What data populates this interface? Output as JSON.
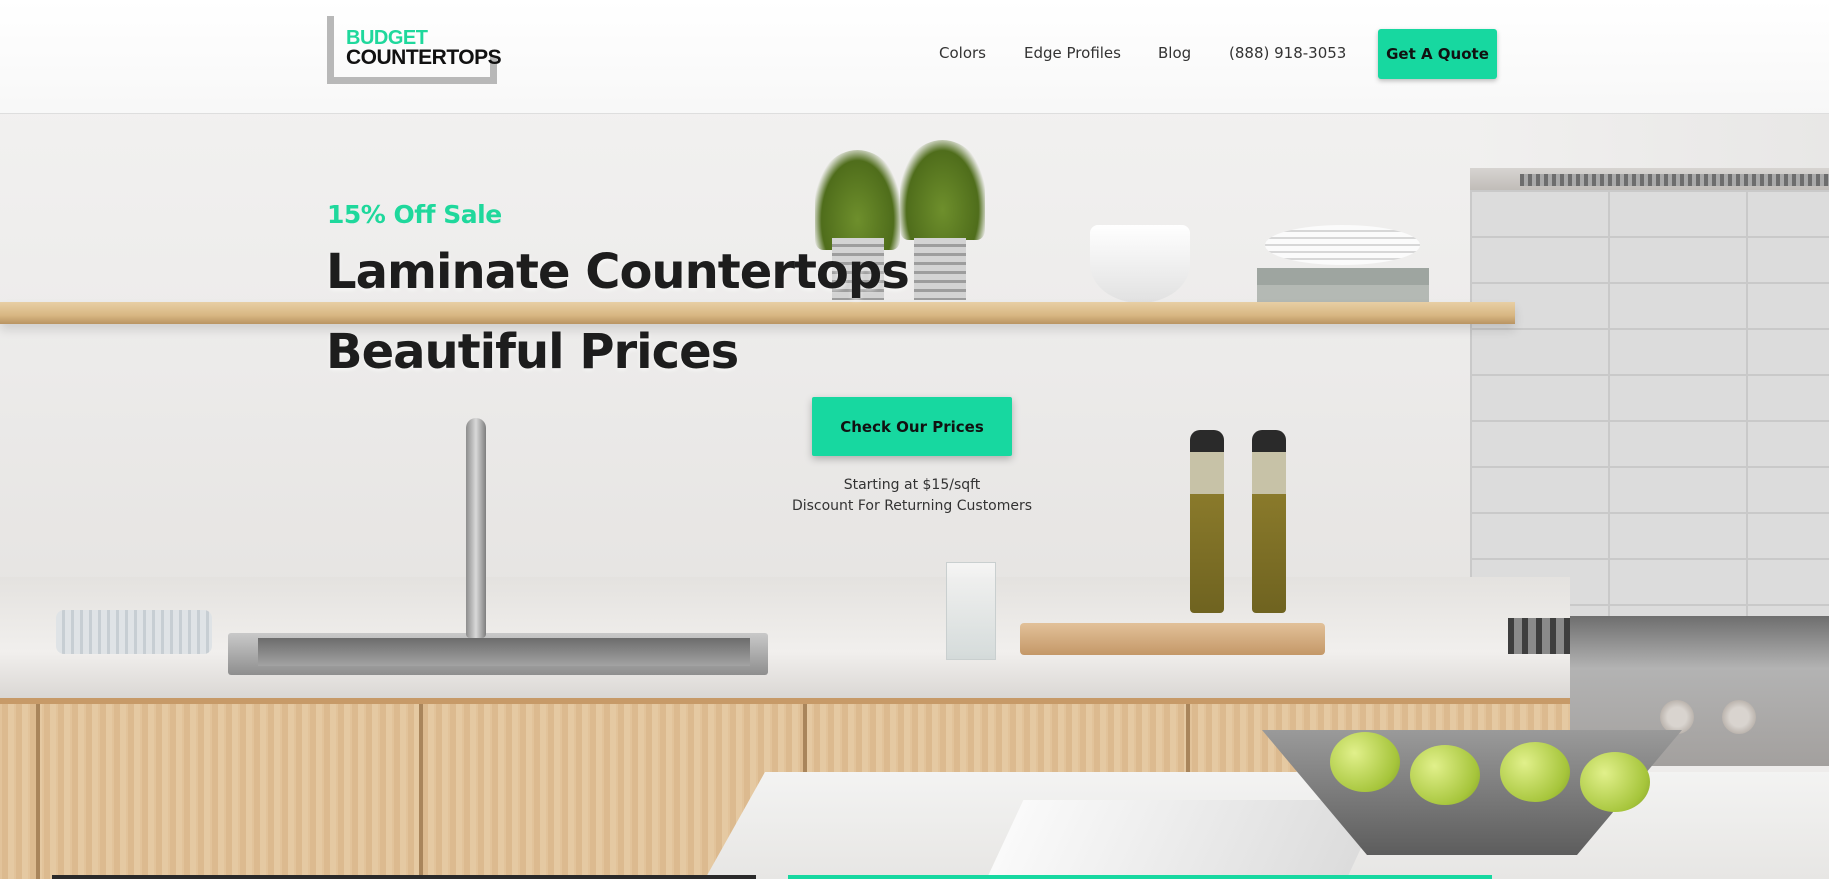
{
  "header": {
    "logo": {
      "line1": "BUDGET",
      "line2": "COUNTERTOPS"
    },
    "nav": [
      {
        "label": "Colors"
      },
      {
        "label": "Edge Profiles"
      },
      {
        "label": "Blog"
      },
      {
        "label": "(888) 918-3053"
      }
    ],
    "quote_button": "Get A Quote"
  },
  "hero": {
    "sale_text": "15% Off Sale",
    "headline_line1": "Laminate Countertops",
    "headline_line2": "Beautiful Prices",
    "cta_button": "Check Our Prices",
    "sub_line1": "Starting at $15/sqft",
    "sub_line2": "Discount For Returning Customers"
  },
  "colors": {
    "accent": "#17d8a0",
    "text_dark": "#1d1d1d"
  }
}
